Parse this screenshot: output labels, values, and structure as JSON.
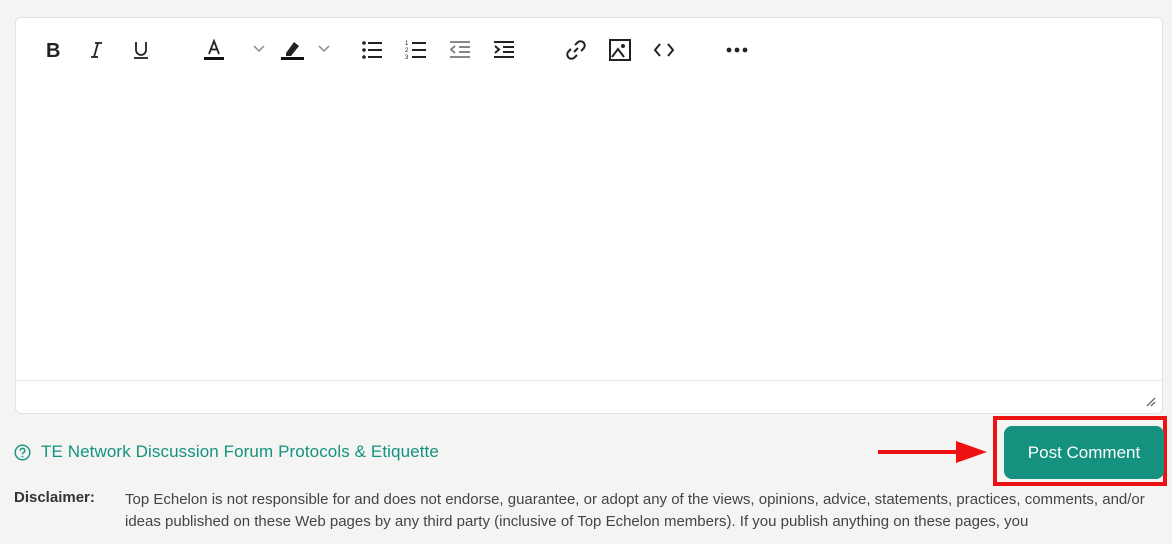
{
  "toolbar": {
    "buttons": [
      {
        "name": "bold-button",
        "icon": "bold-icon"
      },
      {
        "name": "italic-button",
        "icon": "italic-icon"
      },
      {
        "name": "underline-button",
        "icon": "underline-icon"
      },
      {
        "name": "text-color-button",
        "icon": "text-color-icon"
      },
      {
        "name": "highlight-color-button",
        "icon": "highlighter-icon"
      },
      {
        "name": "bullet-list-button",
        "icon": "bullet-list-icon"
      },
      {
        "name": "numbered-list-button",
        "icon": "numbered-list-icon"
      },
      {
        "name": "decrease-indent-button",
        "icon": "outdent-icon"
      },
      {
        "name": "increase-indent-button",
        "icon": "indent-icon"
      },
      {
        "name": "insert-link-button",
        "icon": "link-icon"
      },
      {
        "name": "insert-image-button",
        "icon": "image-icon"
      },
      {
        "name": "code-button",
        "icon": "code-icon"
      },
      {
        "name": "more-options-button",
        "icon": "more-horizontal-icon"
      }
    ]
  },
  "guidelines": {
    "icon": "question-circle-icon",
    "link_text": "TE Network Discussion Forum Protocols & Etiquette"
  },
  "post_button": {
    "label": "Post Comment"
  },
  "disclaimer": {
    "label": "Disclaimer:",
    "text": "Top Echelon is not responsible for and does not endorse, guarantee, or adopt any of the views, opinions, advice, statements, practices, comments, and/or ideas published on these Web pages by any third party (inclusive of Top Echelon members). If you publish anything on these pages, you"
  },
  "colors": {
    "accent": "#14927f",
    "highlight_box": "#ee1111",
    "arrow": "#ee1111",
    "background": "#f4f4f2"
  }
}
